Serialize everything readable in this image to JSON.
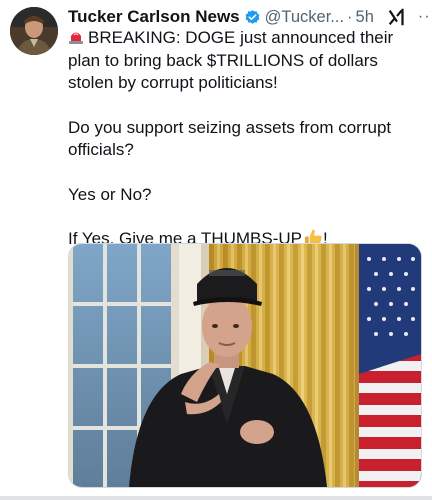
{
  "tweet": {
    "author_name": "Tucker Carlson News",
    "handle": "@Tucker...",
    "separator": "·",
    "time": "5h",
    "verified_color": "#1d9bf0",
    "more_label": "···",
    "paragraphs": [
      "BREAKING: DOGE just announced their plan to bring back $TRILLIONS of dollars stolen by corrupt politicians!",
      "Do you support seizing assets from corrupt officials?",
      "Yes or No?",
      "If Yes, Give me a THUMBS-UP"
    ],
    "thumb_suffix": "!",
    "icons": [
      "verified-badge-icon",
      "grok-icon",
      "more-icon",
      "siren-emoji-icon",
      "thumbs-up-emoji-icon"
    ]
  }
}
